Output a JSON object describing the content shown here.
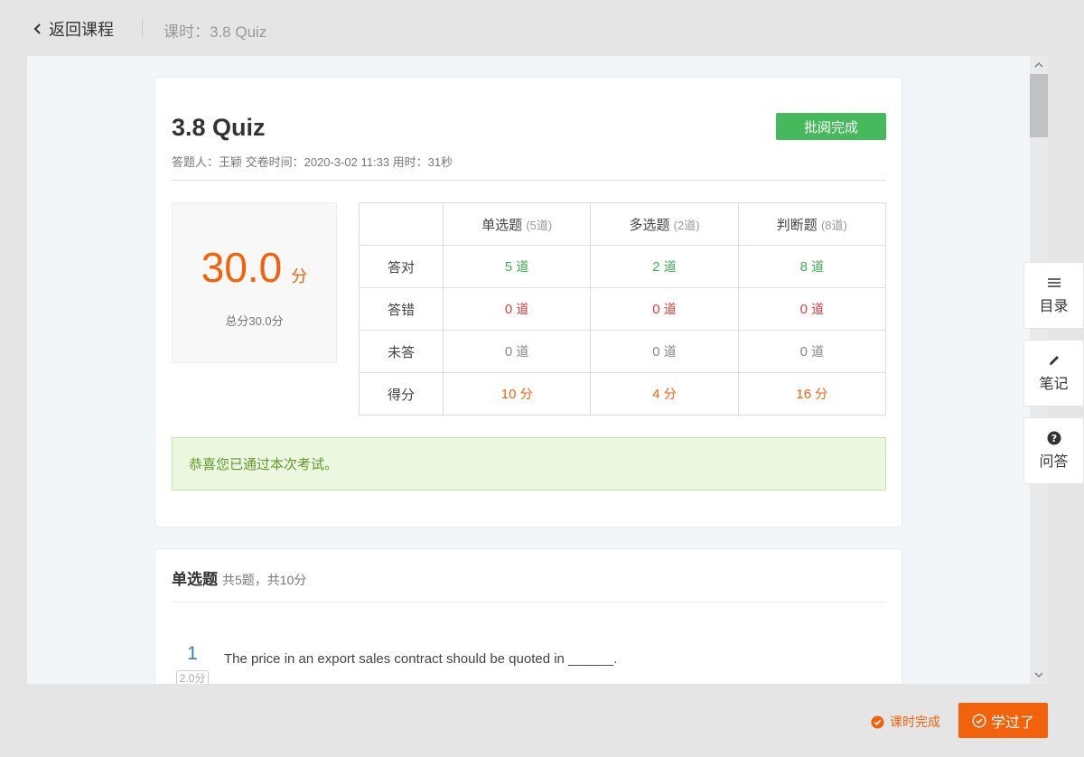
{
  "nav": {
    "back_label": "返回课程",
    "lesson_title": "课时：3.8 Quiz"
  },
  "summary": {
    "title": "3.8 Quiz",
    "grade_button": "批阅完成",
    "meta": "答题人：王颖 交卷时间：2020-3-02 11:33 用时：31秒",
    "score": "30.0",
    "score_unit": "分",
    "total": "总分30.0分",
    "table": {
      "headers": [
        {
          "name": "单选题",
          "count": "(5道)"
        },
        {
          "name": "多选题",
          "count": "(2道)"
        },
        {
          "name": "判断题",
          "count": "(8道)"
        }
      ],
      "rows": [
        {
          "label": "答对",
          "values": [
            "5",
            "2",
            "8"
          ],
          "unit": "道"
        },
        {
          "label": "答错",
          "values": [
            "0",
            "0",
            "0"
          ],
          "unit": "道"
        },
        {
          "label": "未答",
          "values": [
            "0",
            "0",
            "0"
          ],
          "unit": "道"
        },
        {
          "label": "得分",
          "values": [
            "10",
            "4",
            "16"
          ],
          "unit": "分"
        }
      ]
    },
    "pass_message": "恭喜您已通过本次考试。"
  },
  "section": {
    "title": "单选题",
    "subtitle": "共5题，共10分",
    "question": {
      "number": "1",
      "points": "2.0分",
      "text": "The price in an export sales contract should be quoted in ______."
    }
  },
  "tools": {
    "toc": "目录",
    "notes": "笔记",
    "qa": "问答"
  },
  "footer": {
    "status": "课时完成",
    "learned_button": "学过了"
  },
  "colors": {
    "accent": "#f2620a",
    "success": "#45b95b",
    "error": "#e03d3d",
    "link": "#3a7db5"
  }
}
